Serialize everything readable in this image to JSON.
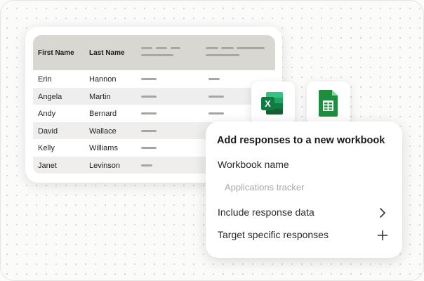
{
  "table": {
    "headers": [
      "First Name",
      "Last Name"
    ],
    "rows": [
      {
        "first": "Erin",
        "last": "Hannon"
      },
      {
        "first": "Angela",
        "last": "Martin"
      },
      {
        "first": "Andy",
        "last": "Bernard"
      },
      {
        "first": "David",
        "last": "Wallace"
      },
      {
        "first": "Kelly",
        "last": "Williams"
      },
      {
        "first": "Janet",
        "last": "Levinson"
      }
    ]
  },
  "icons": {
    "excel": {
      "name": "excel-icon",
      "letter": "X",
      "color": "#107c41"
    },
    "sheets": {
      "name": "google-sheets-icon",
      "color": "#1e8e3e"
    }
  },
  "panel": {
    "title": "Add responses to a new workbook",
    "workbook_label": "Workbook name",
    "workbook_placeholder": "Applications tracker",
    "option_include": "Include response data",
    "option_target": "Target specific responses"
  }
}
